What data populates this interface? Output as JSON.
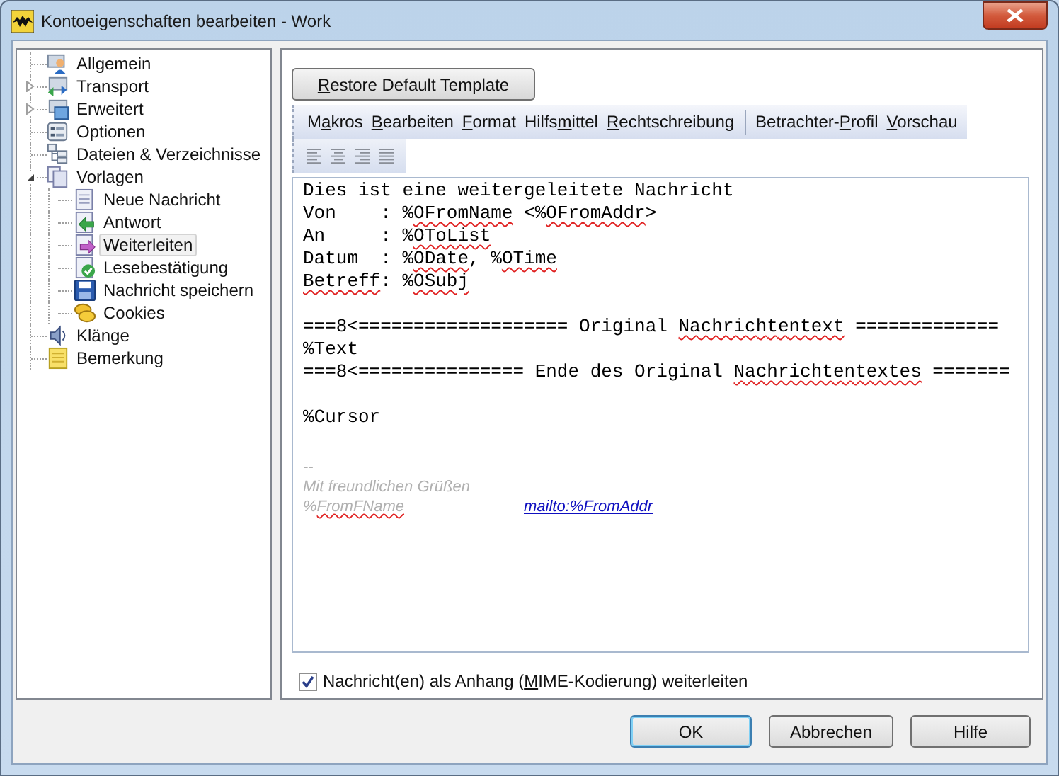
{
  "window": {
    "title": "Kontoeigenschaften bearbeiten - Work"
  },
  "tree": [
    {
      "label": "Allgemein",
      "kind": "person",
      "selected": false
    },
    {
      "label": "Transport",
      "kind": "transport",
      "selected": false,
      "expanded": false
    },
    {
      "label": "Erweitert",
      "kind": "window",
      "selected": false,
      "expanded": false
    },
    {
      "label": "Optionen",
      "kind": "options",
      "selected": false
    },
    {
      "label": "Dateien & Verzeichnisse",
      "kind": "files",
      "selected": false
    },
    {
      "label": "Vorlagen",
      "kind": "pages",
      "selected": false,
      "expanded": true,
      "children": [
        {
          "label": "Neue Nachricht",
          "kind": "page",
          "selected": false
        },
        {
          "label": "Antwort",
          "kind": "reply",
          "selected": false
        },
        {
          "label": "Weiterleiten",
          "kind": "forward",
          "selected": true
        },
        {
          "label": "Lesebestätigung",
          "kind": "receipt",
          "selected": false
        },
        {
          "label": "Nachricht speichern",
          "kind": "save",
          "selected": false
        },
        {
          "label": "Cookies",
          "kind": "cookie",
          "selected": false
        }
      ]
    },
    {
      "label": "Klänge",
      "kind": "speaker",
      "selected": false
    },
    {
      "label": "Bemerkung",
      "kind": "note",
      "selected": false
    }
  ],
  "restore_button": {
    "key": "R",
    "post": "estore Default Template"
  },
  "menu": [
    {
      "pre": "M",
      "key": "a",
      "post": "kros",
      "separator_before": false
    },
    {
      "key": "B",
      "post": "earbeiten",
      "separator_before": false
    },
    {
      "key": "F",
      "post": "ormat",
      "separator_before": false
    },
    {
      "pre": "Hilfs",
      "key": "m",
      "post": "ittel",
      "separator_before": false
    },
    {
      "key": "R",
      "post": "echtschreibung",
      "separator_before": false
    },
    {
      "pre": "Betrachter-",
      "key": "P",
      "post": "rofil",
      "separator_before": true
    },
    {
      "key": "V",
      "post": "orschau",
      "separator_before": false
    }
  ],
  "align_buttons": [
    {
      "kind": "left"
    },
    {
      "kind": "center"
    },
    {
      "kind": "right"
    },
    {
      "kind": "justify"
    }
  ],
  "editor": {
    "lines": [
      {
        "blank_before": false,
        "segments": [
          {
            "text": "Dies ist eine weitergeleitete Nachricht",
            "misspelled": false
          }
        ]
      },
      {
        "blank_before": false,
        "segments": [
          {
            "text": "Von    : %",
            "misspelled": false
          },
          {
            "text": "OFromName",
            "misspelled": true
          },
          {
            "text": " <%",
            "misspelled": false
          },
          {
            "text": "OFromAddr",
            "misspelled": true
          },
          {
            "text": ">",
            "misspelled": false
          }
        ]
      },
      {
        "blank_before": false,
        "segments": [
          {
            "text": "An     : %",
            "misspelled": false
          },
          {
            "text": "OToList",
            "misspelled": true
          }
        ]
      },
      {
        "blank_before": false,
        "segments": [
          {
            "text": "Datum  : %",
            "misspelled": false
          },
          {
            "text": "ODate",
            "misspelled": true
          },
          {
            "text": ", %",
            "misspelled": false
          },
          {
            "text": "OTime",
            "misspelled": true
          }
        ]
      },
      {
        "blank_before": false,
        "segments": [
          {
            "text": "Betreff",
            "misspelled": true
          },
          {
            "text": ": %",
            "misspelled": false
          },
          {
            "text": "OSubj",
            "misspelled": true
          }
        ]
      },
      {
        "blank_before": true,
        "segments": [
          {
            "text": "===8<=================== Original ",
            "misspelled": false
          },
          {
            "text": "Nachrichtentext",
            "misspelled": true
          },
          {
            "text": " =============",
            "misspelled": false
          }
        ]
      },
      {
        "blank_before": false,
        "segments": [
          {
            "text": "%Text",
            "misspelled": false
          }
        ]
      },
      {
        "blank_before": false,
        "segments": [
          {
            "text": "===8<=============== Ende des Original ",
            "misspelled": false
          },
          {
            "text": "Nachrichtentextes",
            "misspelled": true
          },
          {
            "text": " =======",
            "misspelled": false
          }
        ]
      },
      {
        "blank_before": true,
        "segments": [
          {
            "text": "%Cursor",
            "misspelled": false
          }
        ]
      }
    ],
    "signature": {
      "dashes": "--",
      "greeting": "Mit freundlichen Grüßen",
      "name_pre": "%",
      "name": "FromFName",
      "link": "mailto:%FromAddr"
    }
  },
  "attach_checkbox": {
    "pre": "Nachricht(en) als Anhang (",
    "key": "M",
    "post": "IME-Kodierung) weiterleiten",
    "checked": true
  },
  "buttons": [
    {
      "label": "OK",
      "default": true
    },
    {
      "label": "Abbrechen",
      "default": false
    },
    {
      "label": "Hilfe",
      "default": false
    }
  ]
}
